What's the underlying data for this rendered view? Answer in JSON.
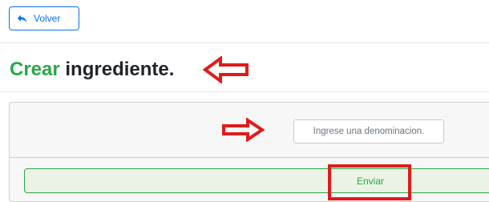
{
  "header": {
    "back_label": "Volver",
    "back_icon": "reply-arrow-icon"
  },
  "page": {
    "title_accent": "Crear",
    "title_rest": "ingrediente."
  },
  "form": {
    "denomination_placeholder": "Ingrese una denominacion.",
    "denomination_value": "",
    "submit_label": "Enviar"
  },
  "annotations": {
    "arrow_color": "#e01b1b",
    "highlight_color": "#e01b1b"
  },
  "colors": {
    "accent_green": "#28a745",
    "primary_blue": "#0d6efd"
  }
}
